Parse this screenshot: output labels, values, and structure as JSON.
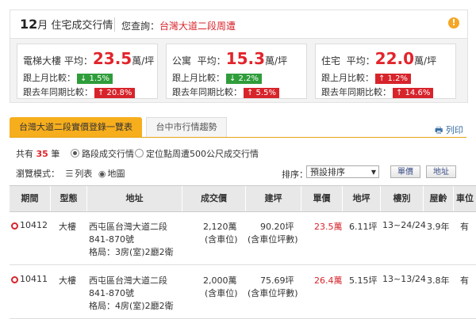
{
  "header": {
    "month": "12",
    "month_suffix": "月 住宅成交行情",
    "query_label": "您查詢：",
    "query_value": "台灣大道二段周遭",
    "info_icon": "!"
  },
  "stats": [
    {
      "type": "電梯大樓",
      "avg_label": "平均：",
      "avg": "23.5",
      "unit": "萬/坪",
      "mom_label": "跟上月比較：",
      "mom": "↓ 1.5%",
      "mom_dir": "down",
      "yoy_label": "跟去年同期比較：",
      "yoy": "↑ 20.8%",
      "yoy_dir": "up"
    },
    {
      "type": "公寓",
      "avg_label": "平均：",
      "avg": "15.3",
      "unit": "萬/坪",
      "mom_label": "跟上月比較：",
      "mom": "↓ 2.2%",
      "mom_dir": "down",
      "yoy_label": "跟去年同期比較：",
      "yoy": "↑ 5.5%",
      "yoy_dir": "up"
    },
    {
      "type": "住宅",
      "avg_label": "平均：",
      "avg": "22.0",
      "unit": "萬/坪",
      "mom_label": "跟上月比較：",
      "mom": "↑ 1.2%",
      "mom_dir": "up",
      "yoy_label": "跟去年同期比較：",
      "yoy": "↑ 14.6%",
      "yoy_dir": "up"
    }
  ],
  "tabs": [
    {
      "label": "台灣大道二段實價登錄一覽表",
      "active": true
    },
    {
      "label": "台中市行情趨勢",
      "active": false
    }
  ],
  "print_label": "列印",
  "filters": {
    "count_prefix": "共有",
    "count": "35",
    "count_suffix": "筆",
    "radio1": "路段成交行情",
    "radio2": "定位點周遭500公尺成交行情",
    "mode_label": "瀏覽模式：",
    "mode_list": "列表",
    "mode_map": "地圖",
    "sort_label": "排序：",
    "sort_value": "預設排序",
    "btn_price": "單價",
    "btn_address": "地址"
  },
  "table": {
    "columns": [
      "期間",
      "型態",
      "地址",
      "成交價",
      "建坪",
      "單價",
      "地坪",
      "樓別",
      "屋齡",
      "車位"
    ],
    "rows": [
      {
        "period": "10412",
        "type": "大樓",
        "addr1": "西屯區台灣大道二段",
        "addr2": "841-870號",
        "layout": "格局：3房(室)2廳2衛",
        "price": "2,120萬",
        "price_note": "(含車位)",
        "area": "90.20坪",
        "area_note": "(含車位坪數)",
        "unit_price": "23.5萬",
        "land": "6.11坪",
        "floor": "13~24/24",
        "age": "3.9年",
        "parking": "有"
      },
      {
        "period": "10411",
        "type": "大樓",
        "addr1": "西屯區台灣大道二段",
        "addr2": "841-870號",
        "layout": "格局：4房(室)2廳2衛",
        "price": "2,000萬",
        "price_note": "(含車位)",
        "area": "75.69坪",
        "area_note": "(含車位坪數)",
        "unit_price": "26.4萬",
        "land": "5.15坪",
        "floor": "13~13/24",
        "age": "3.8年",
        "parking": "有"
      }
    ]
  },
  "colors": {
    "accent": "#f7ae1d",
    "price_red": "#e2242b",
    "up": "#d7242b",
    "down": "#2e9d3a"
  }
}
